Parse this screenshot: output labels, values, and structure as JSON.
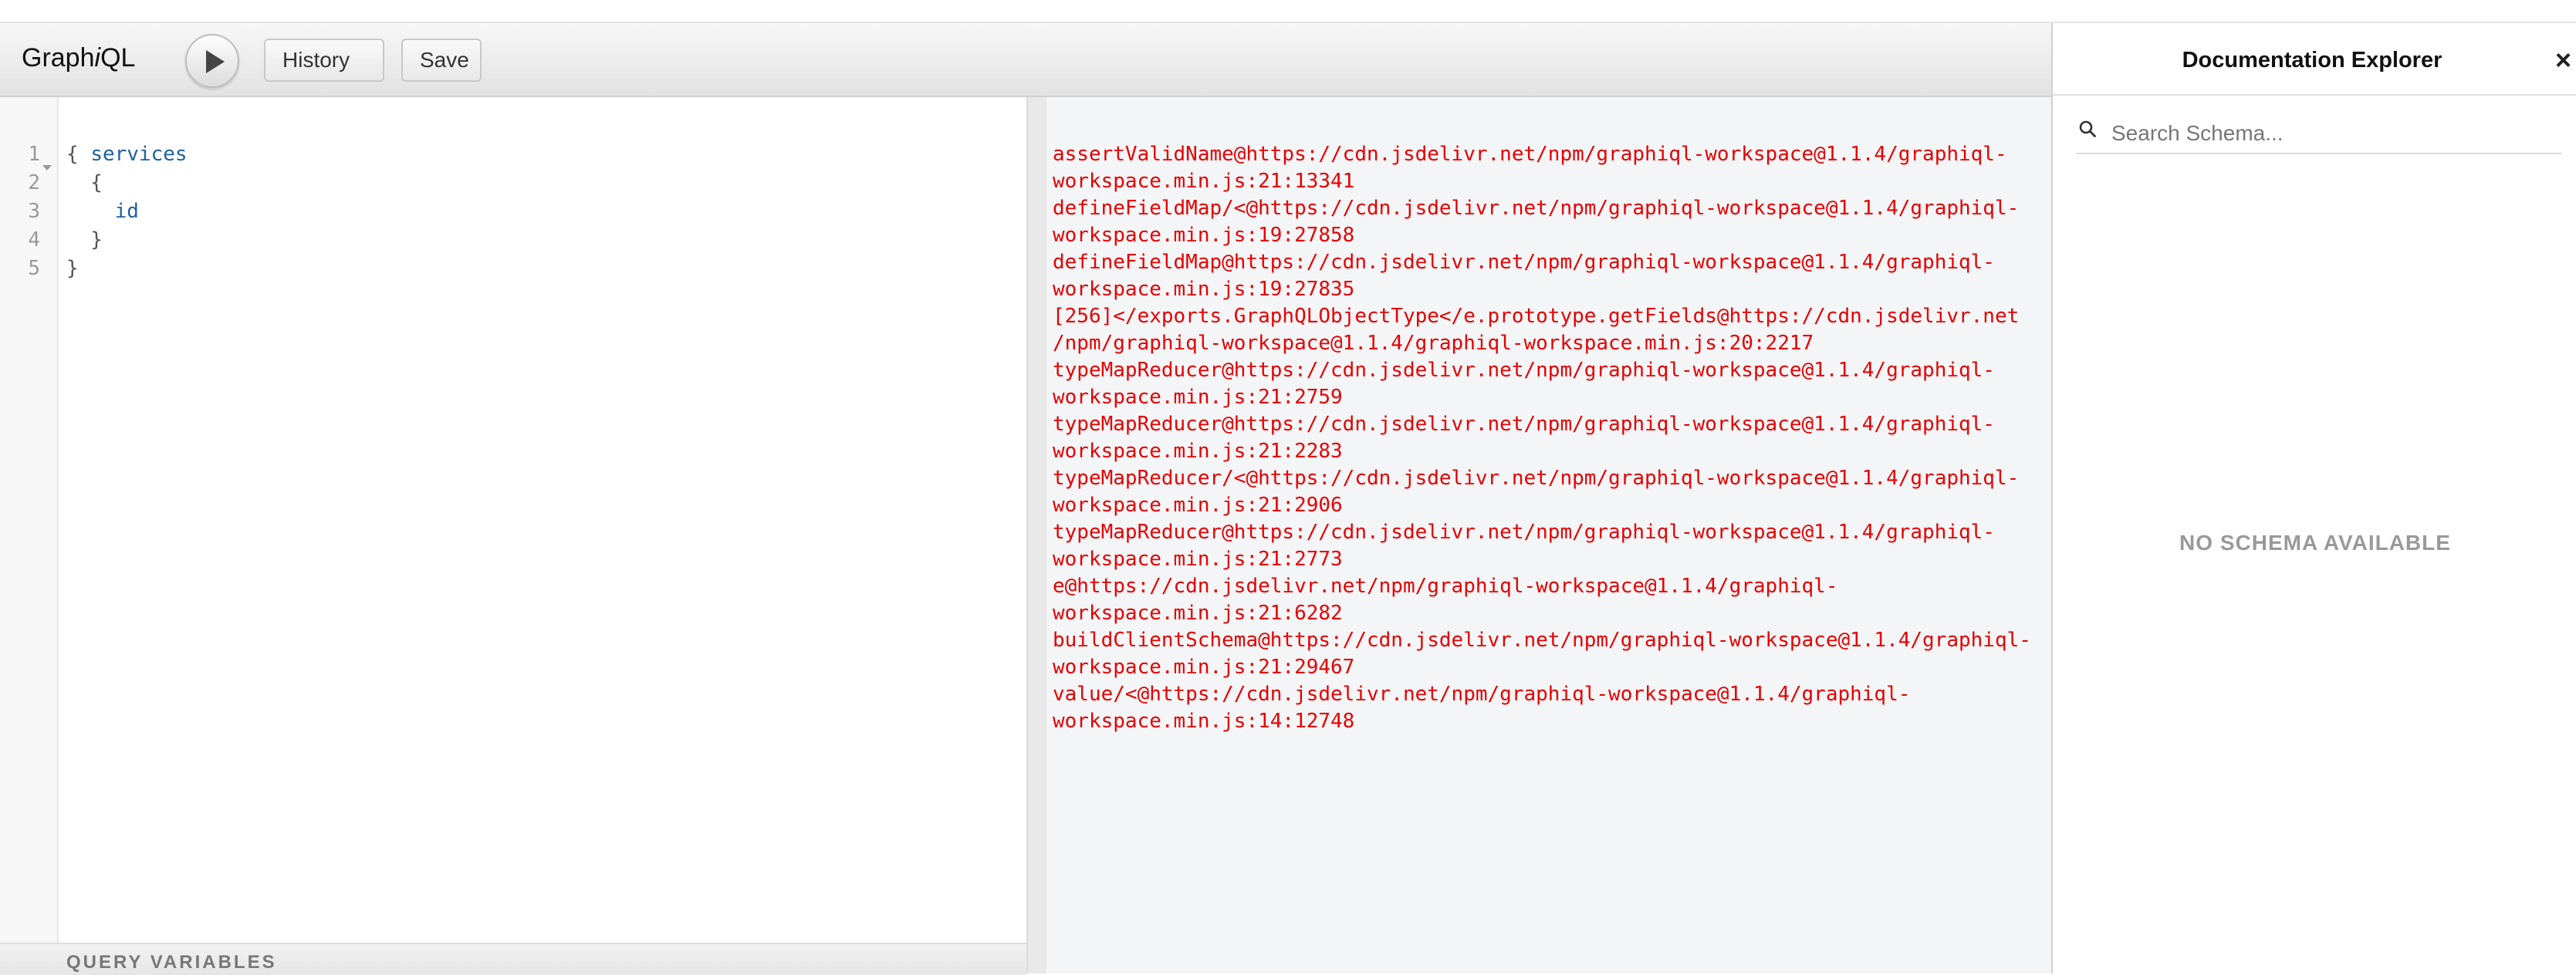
{
  "app": {
    "logo_prefix": "Graph",
    "logo_italic": "i",
    "logo_suffix": "QL"
  },
  "toolbar": {
    "execute_icon": "play-icon",
    "history_label": "History",
    "save_label": "Save"
  },
  "editor": {
    "line_numbers": [
      "1",
      "2",
      "3",
      "4",
      "5"
    ],
    "lines": [
      "{ ",
      "  {",
      "    ",
      "  }",
      "}"
    ],
    "fields": [
      "services",
      "id"
    ]
  },
  "variables": {
    "title": "QUERY VARIABLES"
  },
  "result": {
    "lines": [
      "assertValidName@https://cdn.jsdelivr.net/npm/graphiql-workspace@1.1.4/graphiql-",
      "workspace.min.js:21:13341",
      "defineFieldMap/<@https://cdn.jsdelivr.net/npm/graphiql-workspace@1.1.4/graphiql-",
      "workspace.min.js:19:27858",
      "defineFieldMap@https://cdn.jsdelivr.net/npm/graphiql-workspace@1.1.4/graphiql-",
      "workspace.min.js:19:27835",
      "[256]</exports.GraphQLObjectType</e.prototype.getFields@https://cdn.jsdelivr.net",
      "/npm/graphiql-workspace@1.1.4/graphiql-workspace.min.js:20:2217",
      "typeMapReducer@https://cdn.jsdelivr.net/npm/graphiql-workspace@1.1.4/graphiql-",
      "workspace.min.js:21:2759",
      "typeMapReducer@https://cdn.jsdelivr.net/npm/graphiql-workspace@1.1.4/graphiql-",
      "workspace.min.js:21:2283",
      "typeMapReducer/<@https://cdn.jsdelivr.net/npm/graphiql-workspace@1.1.4/graphiql-",
      "workspace.min.js:21:2906",
      "typeMapReducer@https://cdn.jsdelivr.net/npm/graphiql-workspace@1.1.4/graphiql-",
      "workspace.min.js:21:2773",
      "e@https://cdn.jsdelivr.net/npm/graphiql-workspace@1.1.4/graphiql-",
      "workspace.min.js:21:6282",
      "buildClientSchema@https://cdn.jsdelivr.net/npm/graphiql-workspace@1.1.4/graphiql-",
      "workspace.min.js:21:29467",
      "value/<@https://cdn.jsdelivr.net/npm/graphiql-workspace@1.1.4/graphiql-",
      "workspace.min.js:14:12748"
    ],
    "error_color": "#e60000"
  },
  "docs": {
    "title": "Documentation Explorer",
    "close_label": "×",
    "search_placeholder": "Search Schema...",
    "empty_message": "NO SCHEMA AVAILABLE",
    "search_icon": "search-icon",
    "close_icon": "close-icon"
  }
}
